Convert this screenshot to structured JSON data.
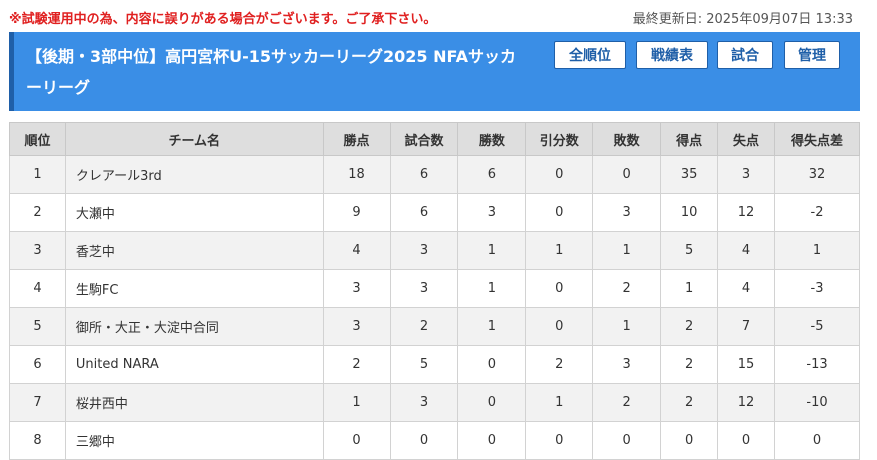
{
  "notice": "※試験運用中の為、内容に誤りがある場合がございます。ご了承下さい。",
  "last_updated": "最終更新日: 2025年09月07日 13:33",
  "title": "【後期・3部中位】高円宮杯U-15サッカーリーグ2025 NFAサッカーリーグ",
  "nav": [
    "全順位",
    "戦績表",
    "試合",
    "管理"
  ],
  "columns": [
    "順位",
    "チーム名",
    "勝点",
    "試合数",
    "勝数",
    "引分数",
    "敗数",
    "得点",
    "失点",
    "得失点差"
  ],
  "rows": [
    [
      "1",
      "クレアール3rd",
      "18",
      "6",
      "6",
      "0",
      "0",
      "35",
      "3",
      "32"
    ],
    [
      "2",
      "大瀬中",
      "9",
      "6",
      "3",
      "0",
      "3",
      "10",
      "12",
      "-2"
    ],
    [
      "3",
      "香芝中",
      "4",
      "3",
      "1",
      "1",
      "1",
      "5",
      "4",
      "1"
    ],
    [
      "4",
      "生駒FC",
      "3",
      "3",
      "1",
      "0",
      "2",
      "1",
      "4",
      "-3"
    ],
    [
      "5",
      "御所・大正・大淀中合同",
      "3",
      "2",
      "1",
      "0",
      "1",
      "2",
      "7",
      "-5"
    ],
    [
      "6",
      "United NARA",
      "2",
      "5",
      "0",
      "2",
      "3",
      "2",
      "15",
      "-13"
    ],
    [
      "7",
      "桜井西中",
      "1",
      "3",
      "0",
      "1",
      "2",
      "2",
      "12",
      "-10"
    ],
    [
      "8",
      "三郷中",
      "0",
      "0",
      "0",
      "0",
      "0",
      "0",
      "0",
      "0"
    ]
  ]
}
